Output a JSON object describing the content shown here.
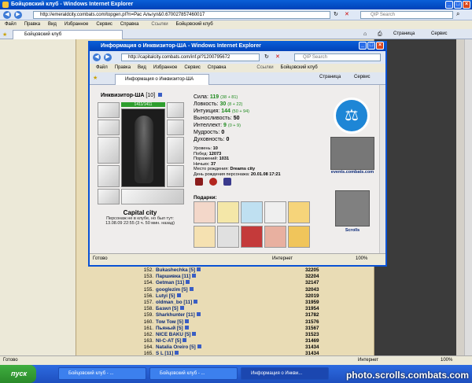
{
  "main_window": {
    "title": "Бойцовский клуб - Windows Internet Explorer",
    "url": "http://emeraldcity.combats.com/topgen.pl?n=Рас Альгул&0.670027857460017",
    "search_placeholder": "QIP Search",
    "menu": [
      "Файл",
      "Правка",
      "Вид",
      "Избранное",
      "Сервис",
      "Справка"
    ],
    "links_label": "Ссылки",
    "links_item": "Бойцовский клуб",
    "tab_label": "Бойцовский клуб",
    "toolbar_page": "Страница",
    "toolbar_service": "Сервис",
    "status_text": "Готово",
    "zone": "Интернет",
    "zoom": "100%"
  },
  "popup": {
    "title": "Информация о Инквизитор-ША - Windows Internet Explorer",
    "url": "http://capitalcity.combats.com/inf.pl?1200795672",
    "search_placeholder": "QIP Search",
    "menu": [
      "Файл",
      "Правка",
      "Вид",
      "Избранное",
      "Сервис",
      "Справка"
    ],
    "links_label": "Ссылки",
    "links_item": "Бойцовский клуб",
    "tab_label": "Информация о Инквизитор-ША",
    "toolbar_page": "Страница",
    "toolbar_service": "Сервис",
    "status_text": "Готово",
    "zone": "Интернет",
    "zoom": "100%"
  },
  "character": {
    "name": "Инквизитор-ША",
    "level": "[10]",
    "hp": "1411/1411",
    "stats": [
      {
        "label": "Сила:",
        "value": "119",
        "extra": "(38 + 81)",
        "color": "#1d8a1d"
      },
      {
        "label": "Ловкость:",
        "value": "30",
        "extra": "(8 + 22)",
        "color": "#1d8a1d"
      },
      {
        "label": "Интуиция:",
        "value": "144",
        "extra": "(50 + 94)",
        "color": "#1d8a1d"
      },
      {
        "label": "Выносливость:",
        "value": "50",
        "extra": "",
        "color": "#000000"
      },
      {
        "label": "Интеллект:",
        "value": "9",
        "extra": "(0 + 9)",
        "color": "#1d8a1d"
      },
      {
        "label": "Мудрость:",
        "value": "0",
        "extra": "",
        "color": "#000000"
      },
      {
        "label": "Духовность:",
        "value": "0",
        "extra": "",
        "color": "#000000"
      }
    ],
    "info": [
      {
        "label": "Уровень:",
        "value": "10"
      },
      {
        "label": "Побед:",
        "value": "12073"
      },
      {
        "label": "Поражений:",
        "value": "1031"
      },
      {
        "label": "Ничьих:",
        "value": "37"
      },
      {
        "label": "Место рождения:",
        "value": "Dreams city"
      },
      {
        "label": "День рождения персонажа:",
        "value": "20.01.08 17:21"
      }
    ],
    "city": "Capital city",
    "city_msg_1": "Персонаж не в клубе, но был тут:",
    "city_msg_2": "13.08.09 22:55 (3 ч. 50 мин. назад)",
    "gifts_label": "Подарки:",
    "events_link": "events.combats.com",
    "scrolls_link": "Scrolls"
  },
  "ranking": [
    {
      "n": "152.",
      "name": "Bukashechka [5]",
      "score": "32205"
    },
    {
      "n": "153.",
      "name": "Паршивка [11]",
      "score": "32204"
    },
    {
      "n": "154.",
      "name": "Getman [11]",
      "score": "32147"
    },
    {
      "n": "155.",
      "name": "googlezim [5]",
      "score": "32043"
    },
    {
      "n": "156.",
      "name": "Lutyi [5]",
      "score": "32019"
    },
    {
      "n": "157.",
      "name": "oldman_bo [11]",
      "score": "31959"
    },
    {
      "n": "158.",
      "name": "Базил [5]",
      "score": "31954"
    },
    {
      "n": "159.",
      "name": "Sharkhunter [11]",
      "score": "31782"
    },
    {
      "n": "160.",
      "name": "Том Том [5]",
      "score": "31576"
    },
    {
      "n": "161.",
      "name": "Пьяный [5]",
      "score": "31567"
    },
    {
      "n": "162.",
      "name": "NICE BAKU [5]",
      "score": "31523"
    },
    {
      "n": "163.",
      "name": "NI-C-AT [5]",
      "score": "31469"
    },
    {
      "n": "164.",
      "name": "Natalia Oreiro [5]",
      "score": "31434"
    },
    {
      "n": "165.",
      "name": "S L [11]",
      "score": "31434"
    }
  ],
  "taskbar": {
    "start": "пуск",
    "items": [
      "Бойцовский клуб - ...",
      "Бойцовский клуб - ...",
      "Информация о Инкви..."
    ]
  },
  "watermark": "photo.scrolls.combats.com"
}
